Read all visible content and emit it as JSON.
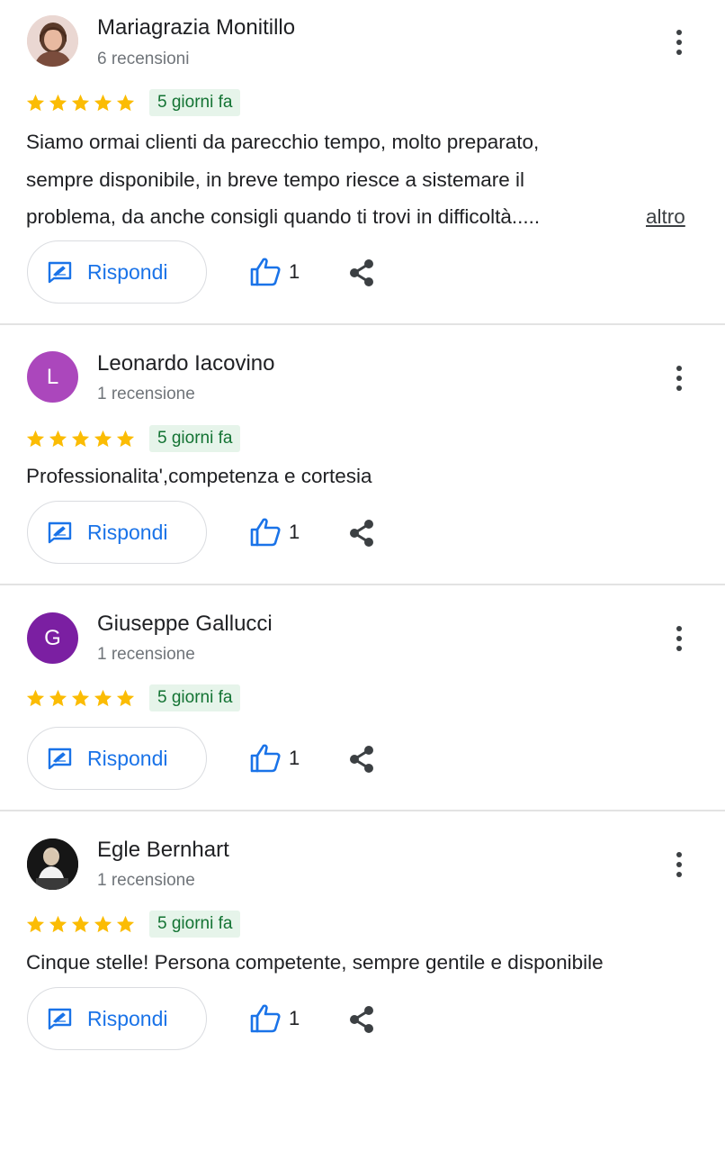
{
  "reviews": [
    {
      "name": "Mariagrazia Monitillo",
      "count": "6 recensioni",
      "avatar": "photo",
      "rating": 5,
      "date": "5 giorni fa",
      "text_lines": [
        "Siamo ormai clienti da parecchio tempo, molto preparato,",
        "sempre disponibile, in breve tempo riesce a sistemare il",
        "problema,  da anche consigli quando ti trovi in difficoltà....."
      ],
      "more_label": "altro",
      "reply_label": "Rispondi",
      "likes": "1"
    },
    {
      "name": "Leonardo Iacovino",
      "count": "1 recensione",
      "avatar": "L",
      "avatar_color": "#ab47bc",
      "rating": 5,
      "date": "5 giorni fa",
      "text_lines": [
        "Professionalita',competenza e cortesia"
      ],
      "reply_label": "Rispondi",
      "likes": "1"
    },
    {
      "name": "Giuseppe Gallucci",
      "count": "1 recensione",
      "avatar": "G",
      "avatar_color": "#7b1fa2",
      "rating": 5,
      "date": "5 giorni fa",
      "text_lines": [],
      "reply_label": "Rispondi",
      "likes": "1"
    },
    {
      "name": "Egle Bernhart",
      "count": "1 recensione",
      "avatar": "photo",
      "rating": 5,
      "date": "5 giorni fa",
      "text_lines": [
        "Cinque stelle! Persona competente,  sempre gentile e disponibile"
      ],
      "reply_label": "Rispondi",
      "likes": "1"
    }
  ],
  "colors": {
    "star": "#fbbc04",
    "accent": "#1a73e8",
    "date_bg": "#e6f4ea",
    "date_text": "#137333"
  },
  "icons": [
    "star-icon",
    "reply-icon",
    "thumbs-up-icon",
    "share-icon",
    "more-vert-icon"
  ]
}
